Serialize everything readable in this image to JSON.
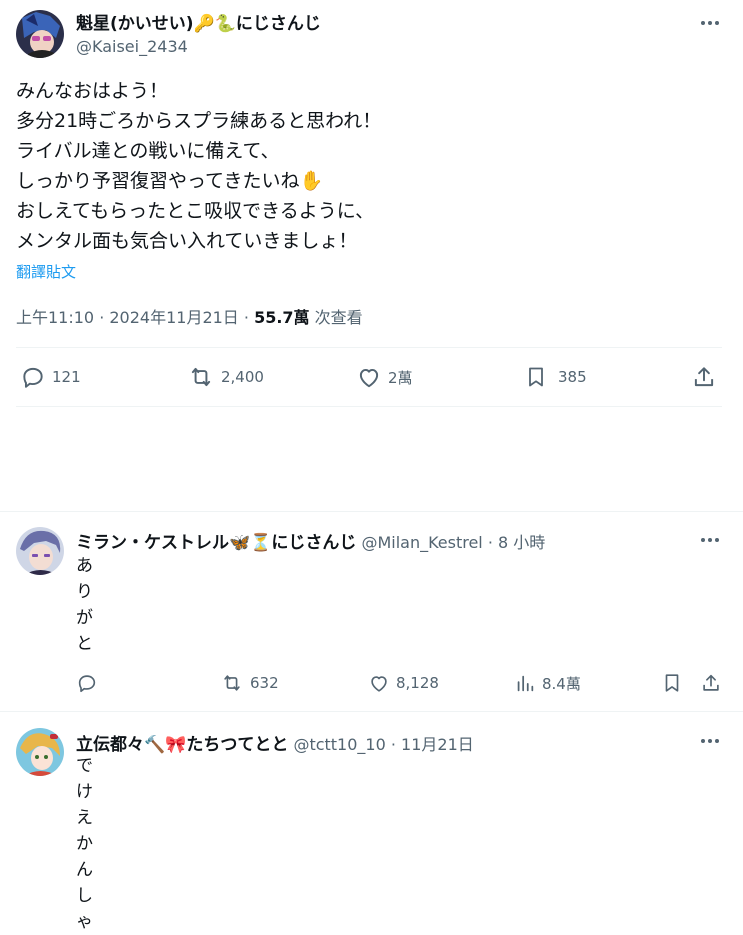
{
  "main_tweet": {
    "author_name": "魁星(かいせい)",
    "author_badges": "🔑🐍",
    "author_suffix": "にじさんじ",
    "handle": "@Kaisei_2434",
    "lines": [
      "みんなおはよう！",
      "多分21時ごろからスプラ練あると思われ！",
      "ライバル達との戦いに備えて、",
      "しっかり予習復習やってきたいね✋",
      "おしえてもらったとこ吸収できるように、",
      "メンタル面も気合い入れていきましょ！"
    ],
    "translate_label": "翻譯貼文",
    "timestamp": "上午11:10 · 2024年11月21日 · ",
    "views_count": "55.7萬",
    "views_label": " 次查看",
    "stats": {
      "replies": "121",
      "retweets": "2,400",
      "likes": "2萬",
      "bookmarks": "385"
    },
    "colors": {
      "link": "#1d9bf0",
      "muted": "#536471"
    }
  },
  "replies": [
    {
      "author_name": "ミラン・ケストレル",
      "author_badges": "🦋⏳",
      "author_suffix": "にじさんじ",
      "handle": "@Milan_Kestrel",
      "time": " · 8 小時",
      "text_chars": [
        "あ",
        "り",
        "が",
        "と"
      ],
      "stats": {
        "replies": "",
        "retweets": "632",
        "likes": "8,128",
        "views": "8.4萬"
      }
    },
    {
      "author_name": "立伝都々",
      "author_badges": "🔨🎀",
      "author_suffix": "たちつてとと",
      "handle": "@tctt10_10",
      "time": " · 11月21日",
      "text_chars": [
        "で",
        "け",
        "え",
        "か",
        "ん",
        "し",
        "ゃ"
      ]
    }
  ]
}
